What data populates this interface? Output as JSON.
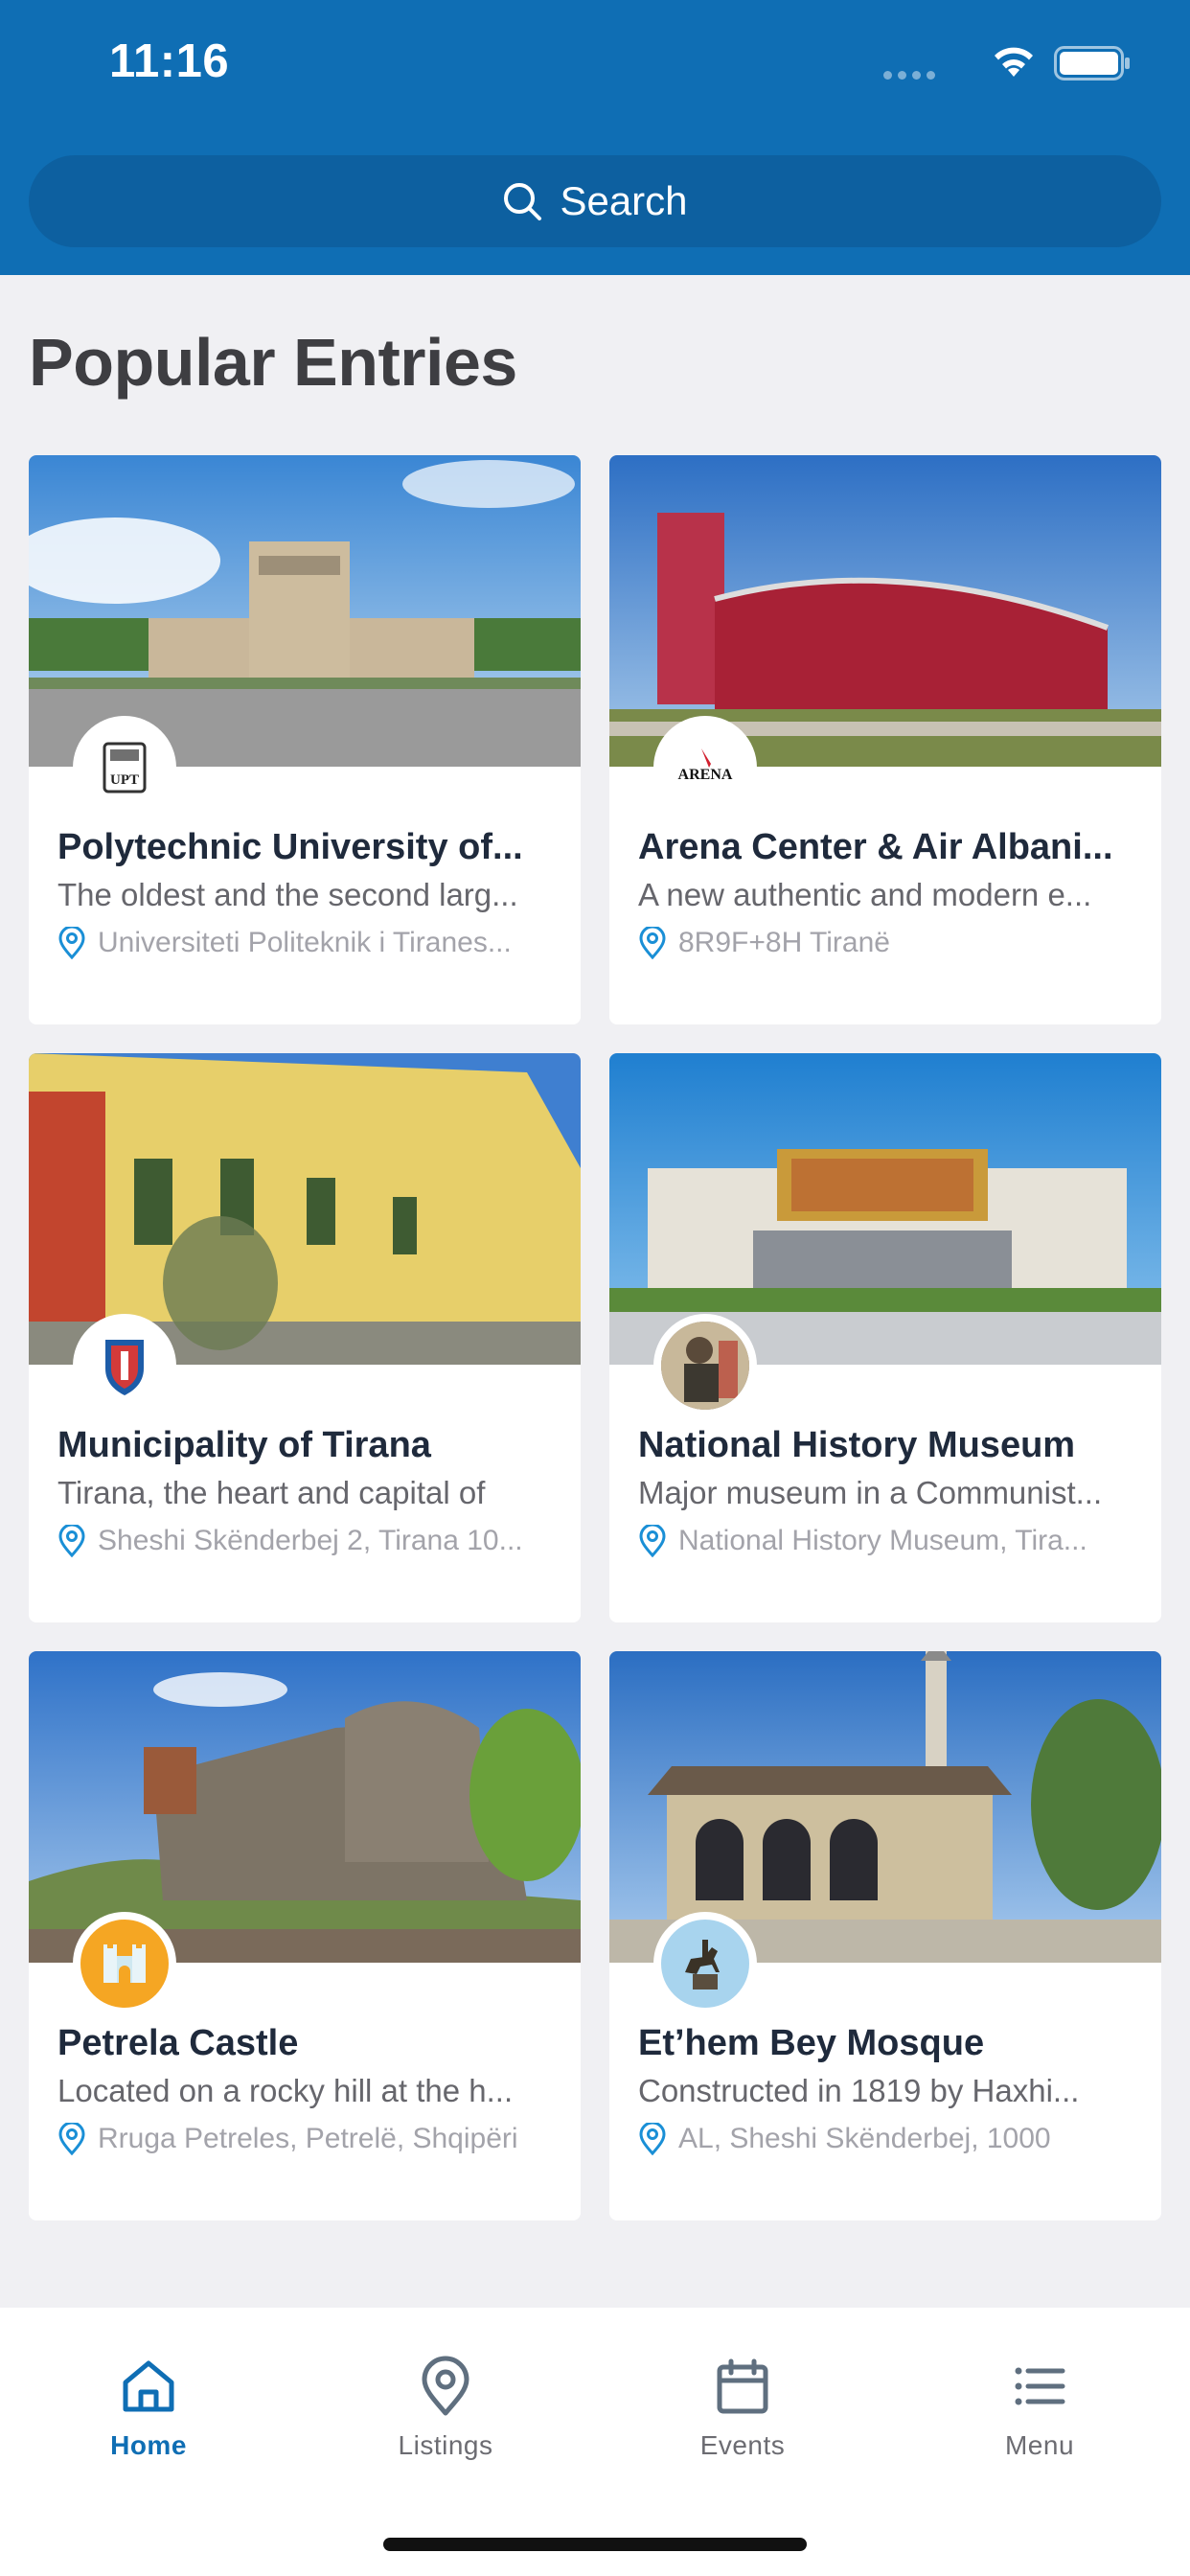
{
  "status_bar": {
    "time": "11:16"
  },
  "search": {
    "label": "Search"
  },
  "section_title": "Popular Entries",
  "colors": {
    "brand": "#0f6eb4",
    "pin": "#1a8fd6"
  },
  "entries": [
    {
      "title": "Polytechnic University of...",
      "description": "The oldest and the second larg...",
      "location": "Universiteti Politeknik i Tiranes...",
      "avatar_icon": "upt-logo-icon",
      "avatar_text": "UPT"
    },
    {
      "title": "Arena Center & Air Albani...",
      "description": "A new authentic and modern e...",
      "location": "8R9F+8H Tiranë",
      "avatar_icon": "arena-logo-icon",
      "avatar_text": "ARENA"
    },
    {
      "title": "Municipality of Tirana",
      "description": "Tirana, the heart and capital of",
      "location": "Sheshi Skënderbej 2, Tirana 10...",
      "avatar_icon": "tirana-crest-icon"
    },
    {
      "title": "National History Museum",
      "description": "Major museum in a Communist...",
      "location": "National History Museum, Tira...",
      "avatar_icon": "museum-mosaic-icon"
    },
    {
      "title": "Petrela Castle",
      "description": "Located on a rocky hill at the h...",
      "location": "Rruga Petreles, Petrelë, Shqipëri",
      "avatar_icon": "castle-icon"
    },
    {
      "title": "Et’hem Bey Mosque",
      "description": "Constructed in 1819 by Haxhi...",
      "location": "AL, Sheshi Skënderbej, 1000",
      "avatar_icon": "horse-statue-icon"
    }
  ],
  "tabs": [
    {
      "label": "Home",
      "icon": "home-icon",
      "active": true
    },
    {
      "label": "Listings",
      "icon": "map-pin-icon",
      "active": false
    },
    {
      "label": "Events",
      "icon": "calendar-icon",
      "active": false
    },
    {
      "label": "Menu",
      "icon": "menu-icon",
      "active": false
    }
  ]
}
